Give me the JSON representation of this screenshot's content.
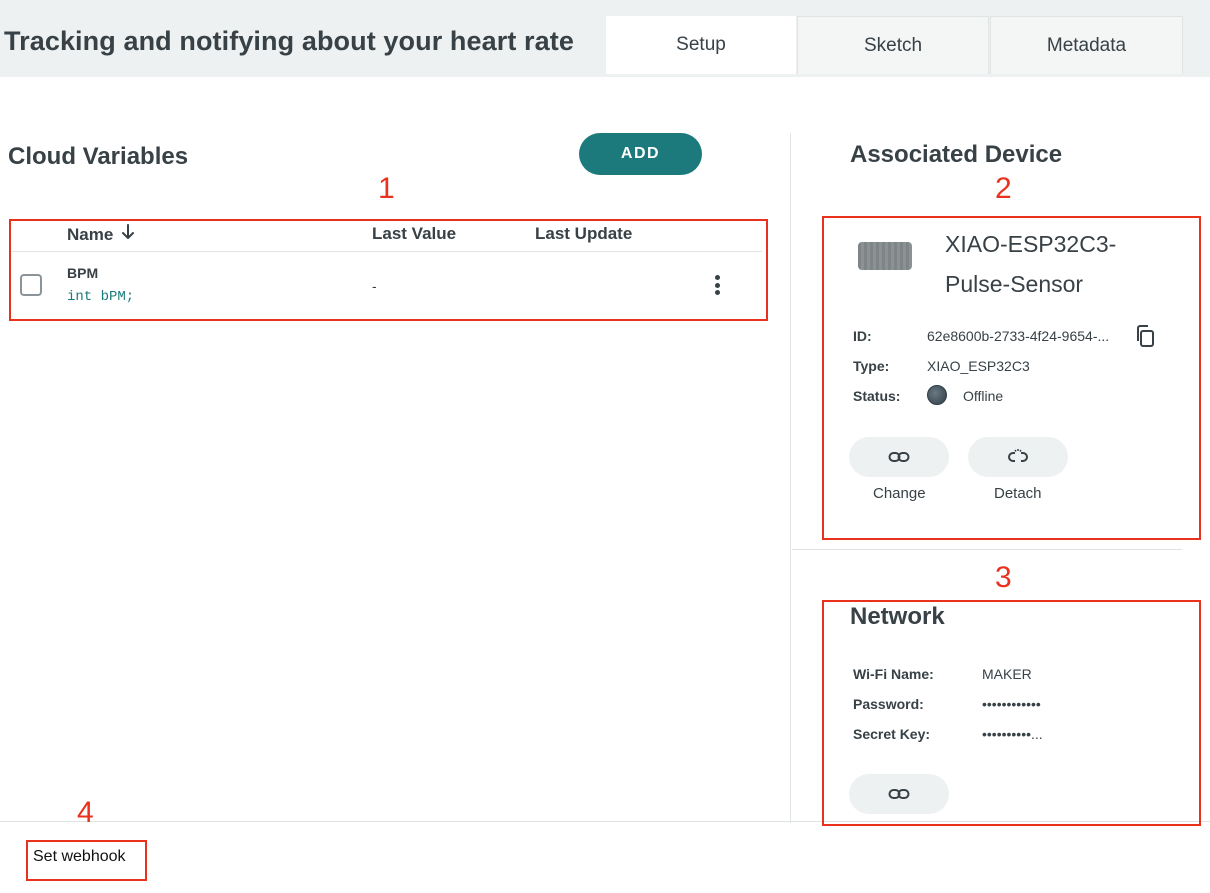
{
  "header": {
    "title": "Tracking and notifying about your heart rate",
    "tabs": [
      {
        "label": "Setup",
        "active": true
      },
      {
        "label": "Sketch",
        "active": false
      },
      {
        "label": "Metadata",
        "active": false
      }
    ]
  },
  "cloud_variables": {
    "title": "Cloud Variables",
    "add_label": "ADD",
    "columns": {
      "name": "Name",
      "last_value": "Last Value",
      "last_update": "Last Update"
    },
    "sort_icon": "arrow-down-icon",
    "rows": [
      {
        "name": "BPM",
        "declaration": "int bPM;",
        "last_value": "-",
        "last_update": ""
      }
    ]
  },
  "device": {
    "title": "Associated Device",
    "name_line1": "XIAO-ESP32C3-",
    "name_line2": "Pulse-Sensor",
    "id_label": "ID:",
    "id_value": "62e8600b-2733-4f24-9654-...",
    "type_label": "Type:",
    "type_value": "XIAO_ESP32C3",
    "status_label": "Status:",
    "status_value": "Offline",
    "change_label": "Change",
    "detach_label": "Detach"
  },
  "network": {
    "title": "Network",
    "wifi_label": "Wi-Fi Name:",
    "wifi_value": "MAKER",
    "password_label": "Password:",
    "password_value": "••••••••••••",
    "secret_label": "Secret Key:",
    "secret_value": "••••••••••..."
  },
  "footer": {
    "webhook_label": "Set webhook"
  },
  "annotations": [
    "1",
    "2",
    "3",
    "4"
  ],
  "colors": {
    "accent": "#1d7a7c",
    "annotation": "#e8321e",
    "text": "#374146"
  }
}
